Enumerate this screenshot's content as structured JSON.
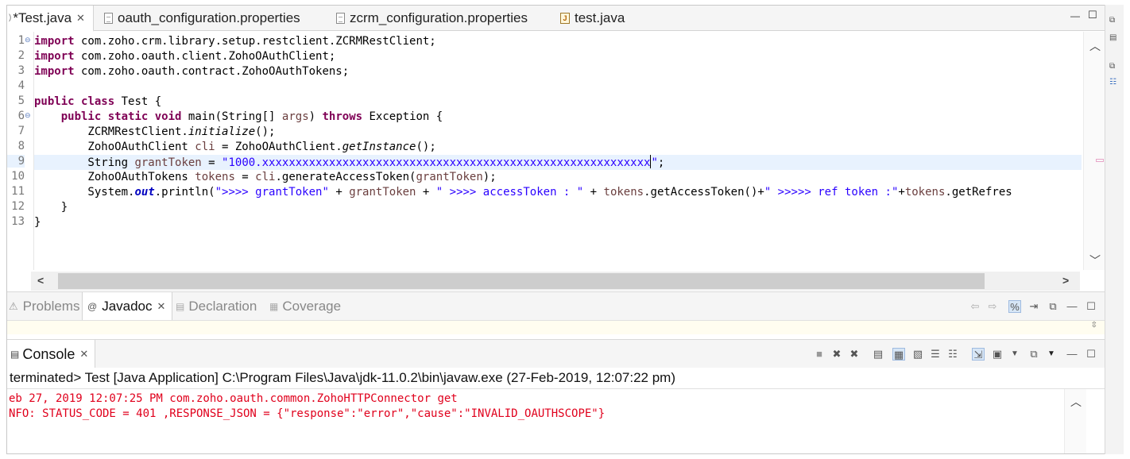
{
  "editor_tabs": [
    {
      "label": "*Test.java",
      "active": true
    },
    {
      "label": "oauth_configuration.properties",
      "active": false
    },
    {
      "label": "zcrm_configuration.properties",
      "active": false
    },
    {
      "label": "test.java",
      "active": false
    }
  ],
  "code_lines": [
    {
      "n": "1",
      "text": "import com.zoho.crm.library.setup.restclient.ZCRMRestClient;"
    },
    {
      "n": "2",
      "text": "import com.zoho.oauth.client.ZohoOAuthClient;"
    },
    {
      "n": "3",
      "text": "import com.zoho.oauth.contract.ZohoOAuthTokens;"
    },
    {
      "n": "4",
      "text": ""
    },
    {
      "n": "5",
      "text": "public class Test {"
    },
    {
      "n": "6",
      "text": "    public static void main(String[] args) throws Exception {"
    },
    {
      "n": "7",
      "text": "        ZCRMRestClient.initialize();"
    },
    {
      "n": "8",
      "text": "        ZohoOAuthClient cli = ZohoOAuthClient.getInstance();"
    },
    {
      "n": "9",
      "text": "        String grantToken = \"1000.xxxxxxxxxxxxxxxxxxxxxxxxxxxxxxxxxxxxxxxxxxxxxxxxxxxxxxxxxx\";"
    },
    {
      "n": "10",
      "text": "        ZohoOAuthTokens tokens = cli.generateAccessToken(grantToken);"
    },
    {
      "n": "11",
      "text": "        System.out.println(\">>>> grantToken\" + grantToken + \" >>>> accessToken : \" + tokens.getAccessToken()+\" >>>>> ref token :\"+tokens.getRefres"
    },
    {
      "n": "12",
      "text": "    }"
    },
    {
      "n": "13",
      "text": "}"
    }
  ],
  "bottom_tabs": [
    {
      "label": "Problems",
      "active": false
    },
    {
      "label": "Javadoc",
      "active": true
    },
    {
      "label": "Declaration",
      "active": false
    },
    {
      "label": "Coverage",
      "active": false
    }
  ],
  "console": {
    "title": "Console",
    "status": "terminated> Test [Java Application] C:\\Program Files\\Java\\jdk-11.0.2\\bin\\javaw.exe (27-Feb-2019, 12:07:22 pm)",
    "output": [
      "eb 27, 2019 12:07:25 PM com.zoho.oauth.common.ZohoHTTPConnector get",
      "NFO: STATUS_CODE = 401 ,RESPONSE_JSON = {\"response\":\"error\",\"cause\":\"INVALID_OAUTHSCOPE\"}"
    ]
  },
  "icons": {
    "close": "close-icon",
    "minimize": "minimize-icon",
    "maximize": "maximize-icon"
  },
  "colors": {
    "keyword": "#7f0055",
    "string": "#2a00ff",
    "local_variable": "#6a3e3e",
    "error_output": "#e0001c",
    "current_line": "#e8f2fe"
  }
}
